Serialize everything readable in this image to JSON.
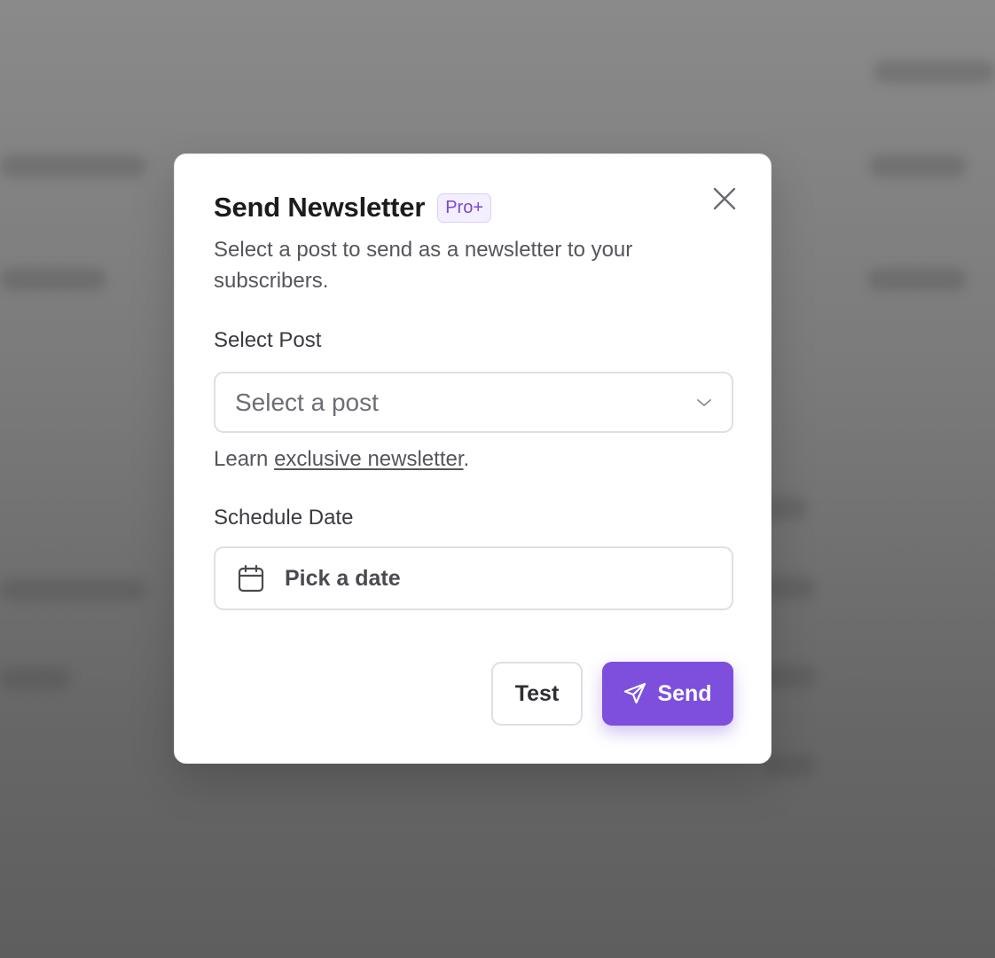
{
  "dialog": {
    "title": "Send Newsletter",
    "badge": "Pro+",
    "subtitle": "Select a post to send as a newsletter to your subscribers.",
    "close_icon": "close-icon"
  },
  "post_field": {
    "label": "Select Post",
    "placeholder": "Select a post",
    "icon": "chevron-down-icon"
  },
  "helper": {
    "prefix": "Learn ",
    "link_text": "exclusive newsletter",
    "suffix": "."
  },
  "date_field": {
    "label": "Schedule Date",
    "placeholder": "Pick a date",
    "icon": "calendar-icon"
  },
  "actions": {
    "test_label": "Test",
    "send_label": "Send",
    "send_icon": "paper-plane-icon"
  },
  "colors": {
    "accent": "#7d4fdc",
    "badge_text": "#7b46d9",
    "badge_bg": "#f4efff"
  }
}
